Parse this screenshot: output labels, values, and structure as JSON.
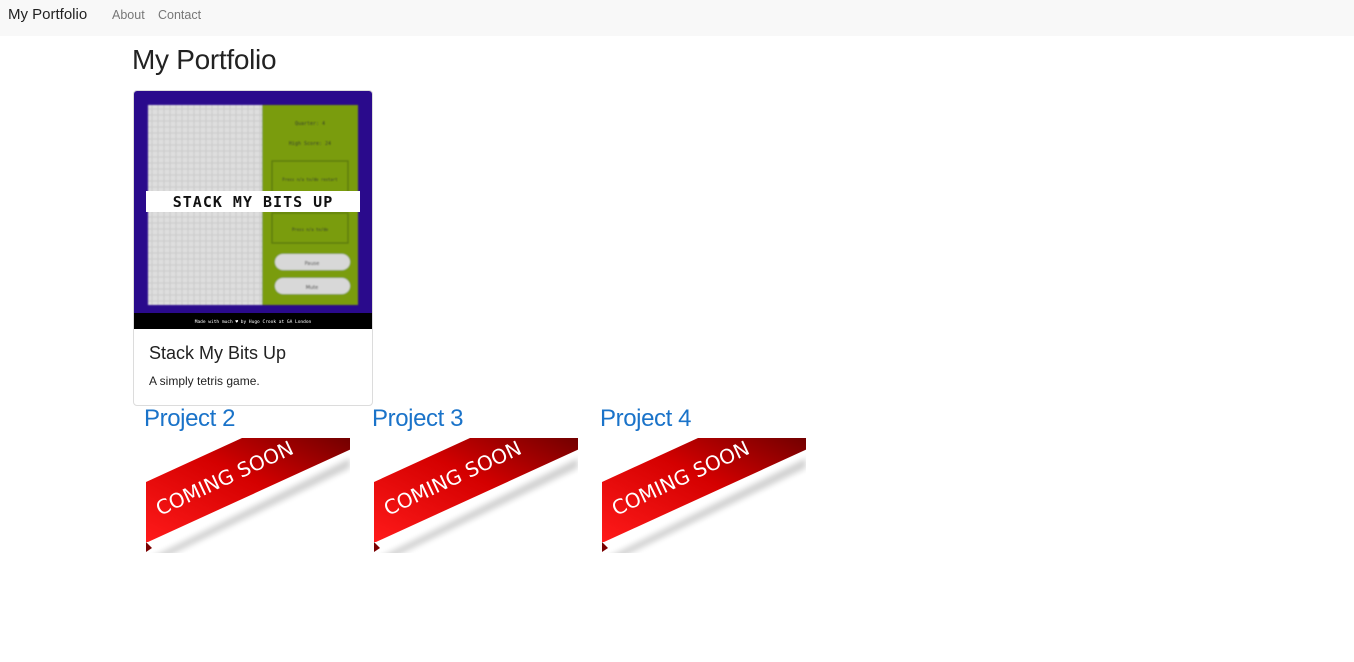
{
  "navbar": {
    "brand": "My Portfolio",
    "links": [
      "About",
      "Contact"
    ]
  },
  "page": {
    "title": "My Portfolio"
  },
  "featured_project": {
    "image": {
      "banner_text": "STACK MY BITS UP",
      "footer_text": "Made with much ♥ by Hugo Crook at GA London",
      "panel_lines": [
        "Quarter: 4",
        "High Score: 24",
        "Press n/a to/do\nrestart",
        "Press n/a to/do"
      ],
      "panel_buttons": [
        "Pause",
        "Mute"
      ]
    },
    "title": "Stack My Bits Up",
    "description": "A simply tetris game."
  },
  "upcoming_projects": [
    {
      "title": "Project 2",
      "ribbon_text": "COMING SOON"
    },
    {
      "title": "Project 3",
      "ribbon_text": "COMING SOON"
    },
    {
      "title": "Project 4",
      "ribbon_text": "COMING SOON"
    }
  ],
  "colors": {
    "link": "#1a73c9",
    "navbar_bg": "#f8f8f8",
    "ribbon_red": "#d40000",
    "game_bg": "#2a0a8c",
    "game_panel": "#7a9c10"
  }
}
